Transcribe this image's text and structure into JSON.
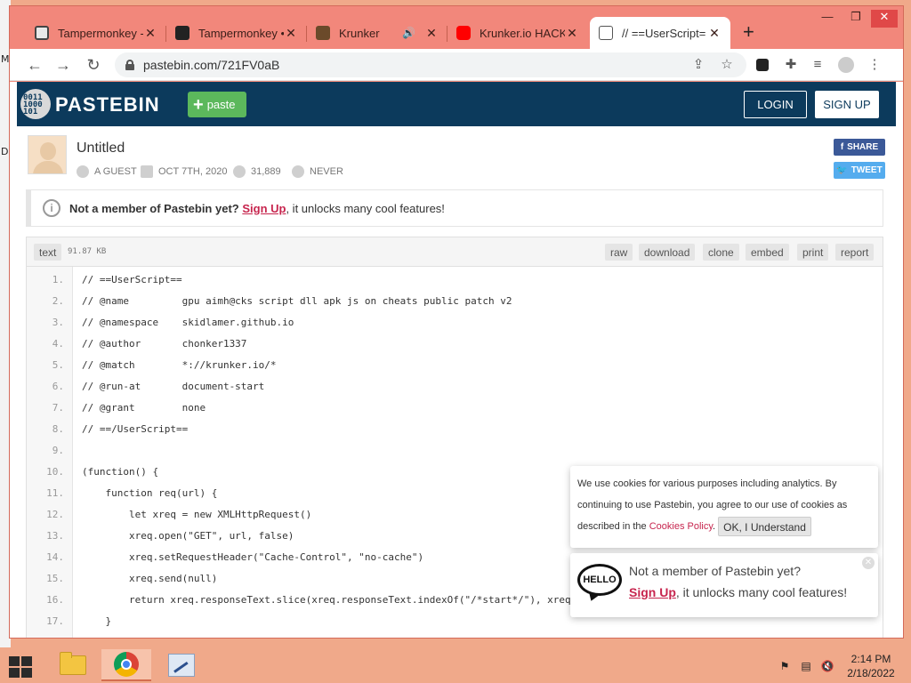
{
  "desktop": {
    "left_labels": [
      "M",
      "D"
    ]
  },
  "browser": {
    "tabs": [
      {
        "label": "Tampermonkey -",
        "close": "✕",
        "icon": "tampermonkey-icon"
      },
      {
        "label": "Tampermonkey •",
        "close": "✕",
        "icon": "tampermonkey-dark-icon"
      },
      {
        "label": "Krunker",
        "close": "✕",
        "icon": "krunker-icon",
        "audio": "🔊"
      },
      {
        "label": "Krunker.io HACK",
        "close": "✕",
        "icon": "youtube-icon"
      },
      {
        "label": "// ==UserScript=",
        "close": "✕",
        "icon": "pastebin-icon"
      }
    ],
    "new_tab": "+",
    "window_controls": {
      "minimize": "—",
      "maximize": "❐",
      "close": "✕"
    },
    "nav": {
      "back": "←",
      "forward": "→",
      "reload": "↻"
    },
    "url": "pastebin.com/721FV0aB"
  },
  "pastebin": {
    "logo_bits": [
      "0011",
      "1000",
      "101"
    ],
    "brand": "PASTEBIN",
    "paste_button": "paste",
    "login": "LOGIN",
    "signup": "SIGN UP",
    "paste_title": "Untitled",
    "meta": {
      "author": "A GUEST",
      "date": "OCT 7TH, 2020",
      "views": "31,889",
      "expiry": "NEVER"
    },
    "share": "SHARE",
    "tweet": "TWEET",
    "notice": {
      "bold": "Not a member of Pastebin yet?",
      "link": "Sign Up",
      "rest": ", it unlocks many cool features!"
    },
    "code_header": {
      "syntax": "text",
      "size": "91.87 KB",
      "buttons": [
        "raw",
        "download",
        "clone",
        "embed",
        "print",
        "report"
      ]
    },
    "code_lines": [
      {
        "n": "1.",
        "text": "// ==UserScript=="
      },
      {
        "n": "2.",
        "text": "// @name         gpu aimh@cks script dll apk js on cheats public patch v2"
      },
      {
        "n": "3.",
        "text": "// @namespace    skidlamer.github.io"
      },
      {
        "n": "4.",
        "text": "// @author       chonker1337"
      },
      {
        "n": "5.",
        "text": "// @match        *://krunker.io/*"
      },
      {
        "n": "6.",
        "text": "// @run-at       document-start"
      },
      {
        "n": "7.",
        "text": "// @grant        none"
      },
      {
        "n": "8.",
        "text": "// ==/UserScript=="
      },
      {
        "n": "9.",
        "text": ""
      },
      {
        "n": "10.",
        "text": "(function() {"
      },
      {
        "n": "11.",
        "text": "    function req(url) {"
      },
      {
        "n": "12.",
        "text": "        let xreq = new XMLHttpRequest()"
      },
      {
        "n": "13.",
        "text": "        xreq.open(\"GET\", url, false)"
      },
      {
        "n": "14.",
        "text": "        xreq.setRequestHeader(\"Cache-Control\", \"no-cache\")"
      },
      {
        "n": "15.",
        "text": "        xreq.send(null)"
      },
      {
        "n": "16.",
        "text": "        return xreq.responseText.slice(xreq.responseText.indexOf(\"/*start*/\"), xreq."
      },
      {
        "n": "17.",
        "text": "    }"
      }
    ],
    "cookie": {
      "text1": "We use cookies for various purposes including analytics. By continuing to use Pastebin, you agree to our use of cookies as described in the ",
      "link": "Cookies Policy",
      "text2": ".",
      "ok": "OK, I Understand"
    },
    "hello_popup": {
      "bubble": "HELLO",
      "question": "Not a member of Pastebin yet?",
      "link": "Sign Up",
      "rest": ", it unlocks many cool features!",
      "close": "✕"
    }
  },
  "taskbar": {
    "time": "2:14 PM",
    "date": "2/18/2022"
  }
}
